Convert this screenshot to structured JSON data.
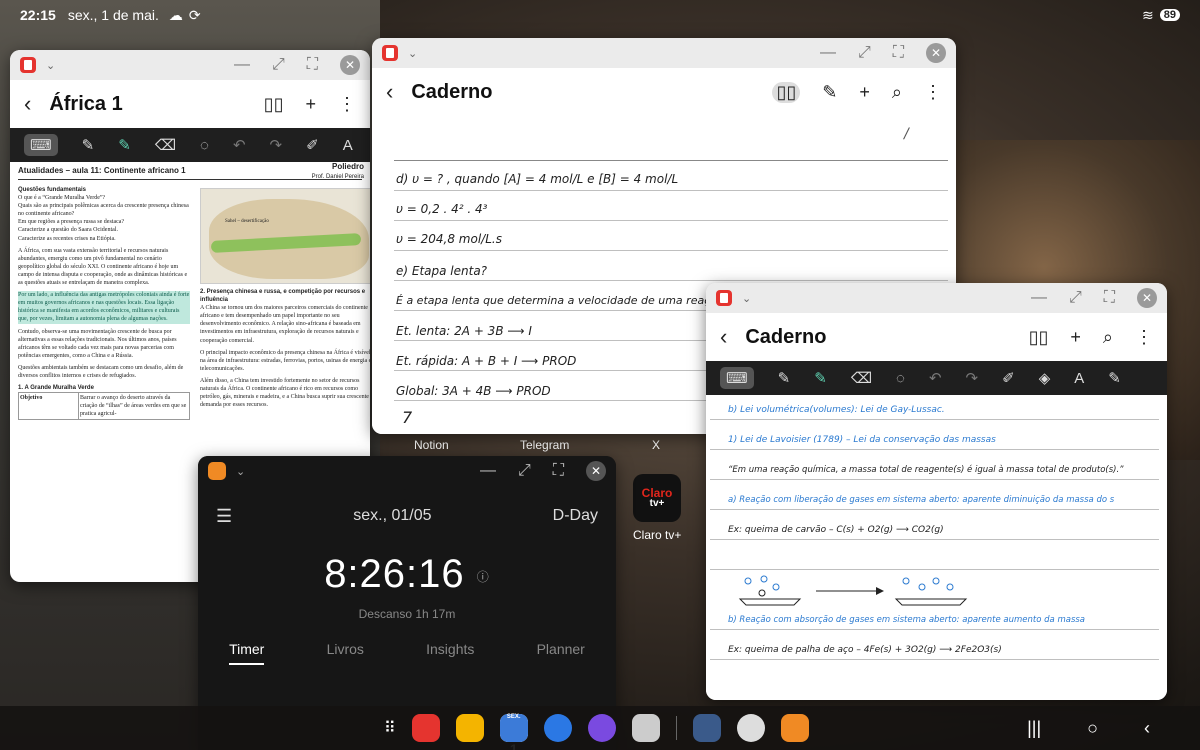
{
  "status_bar": {
    "time": "22:15",
    "date": "sex., 1 de mai.",
    "battery": "89"
  },
  "africa_window": {
    "title": "África 1",
    "doc_header": "Atualidades – aula 11: Continente africano 1",
    "brand": "Poliedro",
    "author": "Prof. Daniel Pereira",
    "section_questions": "Questões fundamentais",
    "questions": [
      "O que é a “Grande Muralha Verde”?",
      "Quais são as principais polêmicas acerca da crescente presença chinesa no continente africano?",
      "Em que regiões a presença russa se destaca?",
      "Caracterize a questão do Saara Ocidental.",
      "Caracterize as recentes crises na Etiópia."
    ],
    "para1": "A África, com sua vasta extensão territorial e recursos naturais abundantes, emergiu como um pivô fundamental no cenário geopolítico global do século XXI. O continente africano é hoje um campo de intensa disputa e cooperação, onde as dinâmicas históricas e as questões atuais se entrelaçam de maneira complexa.",
    "para_highlight": "Por um lado, a influência das antigas metrópoles coloniais ainda é forte em muitos governos africanos e nas questões locais. Essa ligação histórica se manifesta em acordos econômicos, militares e culturais que, por vezes, limitam a autonomia plena de algumas nações.",
    "para2": "Contudo, observa-se uma movimentação crescente de busca por alternativas a essas relações tradicionais. Nos últimos anos, países africanos têm se voltado cada vez mais para novas parcerias com potências emergentes, como a China e a Rússia.",
    "para3": "Questões ambientais também se destacam como um desafio, além de diversos conflitos internos e crises de refugiados.",
    "section_wall": "1. A Grande Muralha Verde",
    "table_header": "Objetivo",
    "table_cell": "Barrar o avanço do deserto através da criação de “ilhas” de áreas verdes em que se pratica agricul-",
    "section_china": "2. Presença chinesa e russa, e competição por recursos e influência",
    "para_china": "A China se tornou um dos maiores parceiros comerciais do continente africano e tem desempenhado um papel importante no seu desenvolvimento econômico. A relação sino-africana é baseada em investimentos em infraestrutura, exploração de recursos naturais e cooperação comercial.",
    "para_china2": "O principal impacto econômico da presença chinesa na África é visível na área de infraestrutura: estradas, ferrovias, portos, usinas de energia e telecomunicações.",
    "para_china3": "Além disso, a China tem investido fortemente no setor de recursos naturais da África. O continente africano é rico em recursos como petróleo, gás, minerais e madeira, e a China busca suprir sua crescente demanda por esses recursos.",
    "map_label": "Sahel – desertificação"
  },
  "caderno1": {
    "title": "Caderno",
    "lines": [
      "d) υ = ? , quando [A] = 4 mol/L e [B] = 4 mol/L",
      "υ = 0,2 . 4² . 4³",
      "υ = 204,8 mol/L.s",
      "e) Etapa lenta?",
      "É a etapa lenta que determina a velocidade de uma reação",
      "Et. lenta:  2A + 3B ⟶ I",
      "Et. rápida:  A + B + I ⟶ PROD",
      "Global:  3A + 4B ⟶ PROD"
    ],
    "margin_mark": "/",
    "page_num": "7"
  },
  "caderno2": {
    "title": "Caderno",
    "lines": [
      "b) Lei volumétrica(volumes): Lei de Gay-Lussac.",
      "1) Lei de Lavoisier (1789) – Lei da conservação das massas",
      "“Em uma reação química, a massa total de reagente(s) é igual à massa total de produto(s).”",
      "a) Reação com liberação de gases em sistema aberto: aparente diminuição da massa do s",
      "Ex: queima de carvão – C(s) + O2(g) ⟶ CO2(g)",
      "b) Reação com absorção de gases em sistema aberto: aparente aumento da massa",
      "Ex: queima de palha de aço – 4Fe(s) + 3O2(g) ⟶ 2Fe2O3(s)"
    ]
  },
  "clock": {
    "date": "sex., 01/05",
    "dday": "D-Day",
    "time": "8:26:16",
    "rest": "Descanso 1h 17m",
    "tabs": [
      "Timer",
      "Livros",
      "Insights",
      "Planner"
    ]
  },
  "home_labels": {
    "notion": "Notion",
    "telegram": "Telegram",
    "x": "X",
    "claro": "Claro tv+",
    "claro_logo": "Claro",
    "claro_sub": "tv+"
  },
  "dock_calendar_day": "1",
  "dock_calendar_label": "SEX."
}
